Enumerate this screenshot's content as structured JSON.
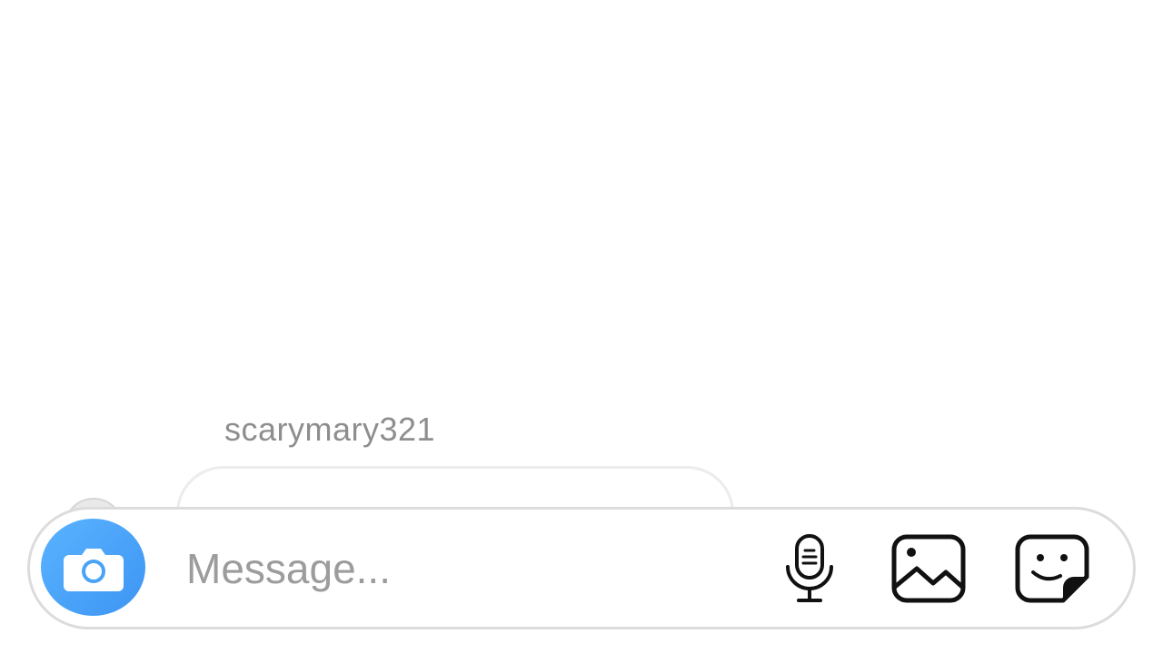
{
  "thread": {
    "sender_username": "scarymary321"
  },
  "composer": {
    "placeholder": "Message...",
    "value": "",
    "camera_icon": "camera-icon",
    "mic_icon": "microphone-icon",
    "gallery_icon": "gallery-icon",
    "sticker_icon": "sticker-icon"
  },
  "colors": {
    "camera_button": "#3d95f3",
    "placeholder_text": "#9c9c9c",
    "username_text": "#8e8e8e",
    "composer_border": "#dcdcdc"
  }
}
